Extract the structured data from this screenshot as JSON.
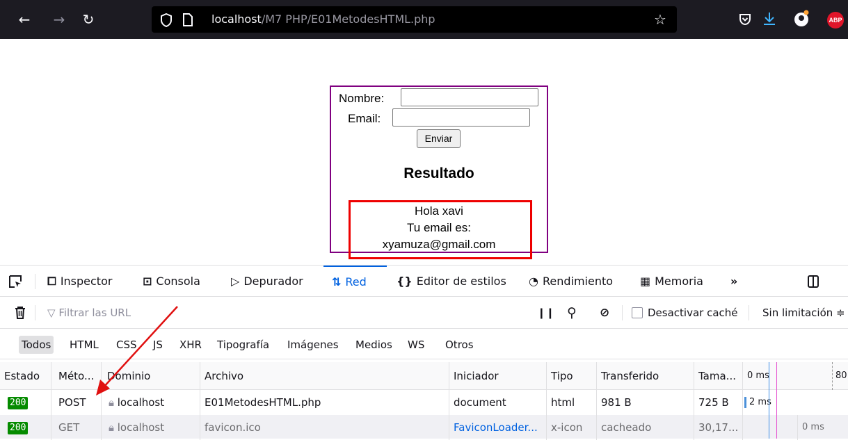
{
  "browser": {
    "url_host": "localhost",
    "url_path": "/M7 PHP/E01MetodesHTML.php",
    "icons": [
      "back-arrow-icon",
      "forward-arrow-icon",
      "reload-icon",
      "shield-icon",
      "page-icon",
      "star-icon",
      "pocket-icon",
      "download-icon",
      "account-icon",
      "adblock-icon"
    ],
    "abp_label": "ABP"
  },
  "page": {
    "nombre_label": "Nombre:",
    "email_label": "Email:",
    "submit_label": "Enviar",
    "result_title": "Resultado",
    "result_lines": [
      "Hola xavi",
      "Tu email es:",
      "xyamuza@gmail.com"
    ]
  },
  "devtools": {
    "tabs": [
      "Inspector",
      "Consola",
      "Depurador",
      "Red",
      "Editor de estilos",
      "Rendimiento",
      "Memoria"
    ],
    "active_tab": "Red",
    "filter_placeholder": "Filtrar las URL",
    "disable_cache_label": "Desactivar caché",
    "throttle_label": "Sin limitación ≑",
    "type_filters": [
      "Todos",
      "HTML",
      "CSS",
      "JS",
      "XHR",
      "Tipografía",
      "Imágenes",
      "Medios",
      "WS",
      "Otros"
    ],
    "columns": [
      "Estado",
      "Méto...",
      "Dominio",
      "Archivo",
      "Iniciador",
      "Tipo",
      "Transferido",
      "Tama...",
      "0 ms",
      "80"
    ],
    "rows": [
      {
        "status": "200",
        "method": "POST",
        "domain": "localhost",
        "file": "E01MetodesHTML.php",
        "initiator": "document",
        "type": "html",
        "transferred": "981 B",
        "size": "725 B",
        "timing": "2 ms"
      },
      {
        "status": "200",
        "method": "GET",
        "domain": "localhost",
        "file": "favicon.ico",
        "initiator": "FaviconLoader...",
        "type": "x-icon",
        "transferred": "cacheado",
        "size": "30,17...",
        "timing": "0 ms"
      }
    ]
  },
  "colors": {
    "annotation_arrow": "#e01010",
    "result_border": "#ee0000",
    "form_border": "#800080",
    "status_ok": "#058b00"
  }
}
